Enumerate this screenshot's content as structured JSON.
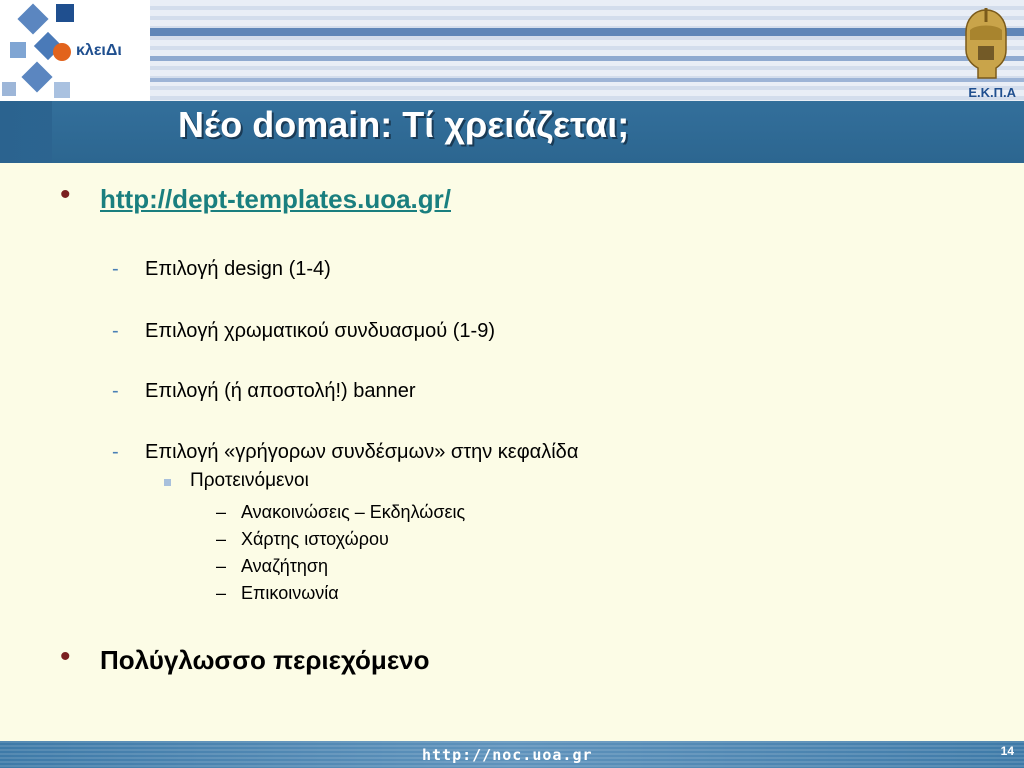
{
  "header": {
    "logo_text": "κλειΔι",
    "crest_label": "Ε.Κ.Π.Α",
    "colors": {
      "title_bar": "#2F6C97",
      "logo_blue": "#1F4F8F",
      "logo_orange": "#E2631C",
      "content_bg": "#FCFCE6"
    }
  },
  "slide": {
    "title": "Νέο domain: Τί χρειάζεται;",
    "bullets": [
      {
        "text": "http://dept-templates.uoa.gr/",
        "is_link": true,
        "children": [
          {
            "marker": "-",
            "text": "Επιλογή design (1-4)"
          },
          {
            "marker": "-",
            "text": "Επιλογή χρωματικού συνδυασμού (1-9)"
          },
          {
            "marker": "-",
            "text": "Επιλογή (ή αποστολή!) banner"
          },
          {
            "marker": "-",
            "text": "Επιλογή «γρήγορων συνδέσμων» στην κεφαλίδα",
            "children": [
              {
                "text": "Προτεινόμενοι",
                "children": [
                  {
                    "marker": "–",
                    "text": "Ανακοινώσεις – Εκδηλώσεις"
                  },
                  {
                    "marker": "–",
                    "text": "Χάρτης ιστοχώρου"
                  },
                  {
                    "marker": "–",
                    "text": "Αναζήτηση"
                  },
                  {
                    "marker": "–",
                    "text": "Επικοινωνία"
                  }
                ]
              }
            ]
          }
        ]
      },
      {
        "text": "Πολύγλωσσο περιεχόμενο",
        "is_link": false
      }
    ]
  },
  "footer": {
    "url": "http://noc.uoa.gr",
    "page_number": "14"
  }
}
